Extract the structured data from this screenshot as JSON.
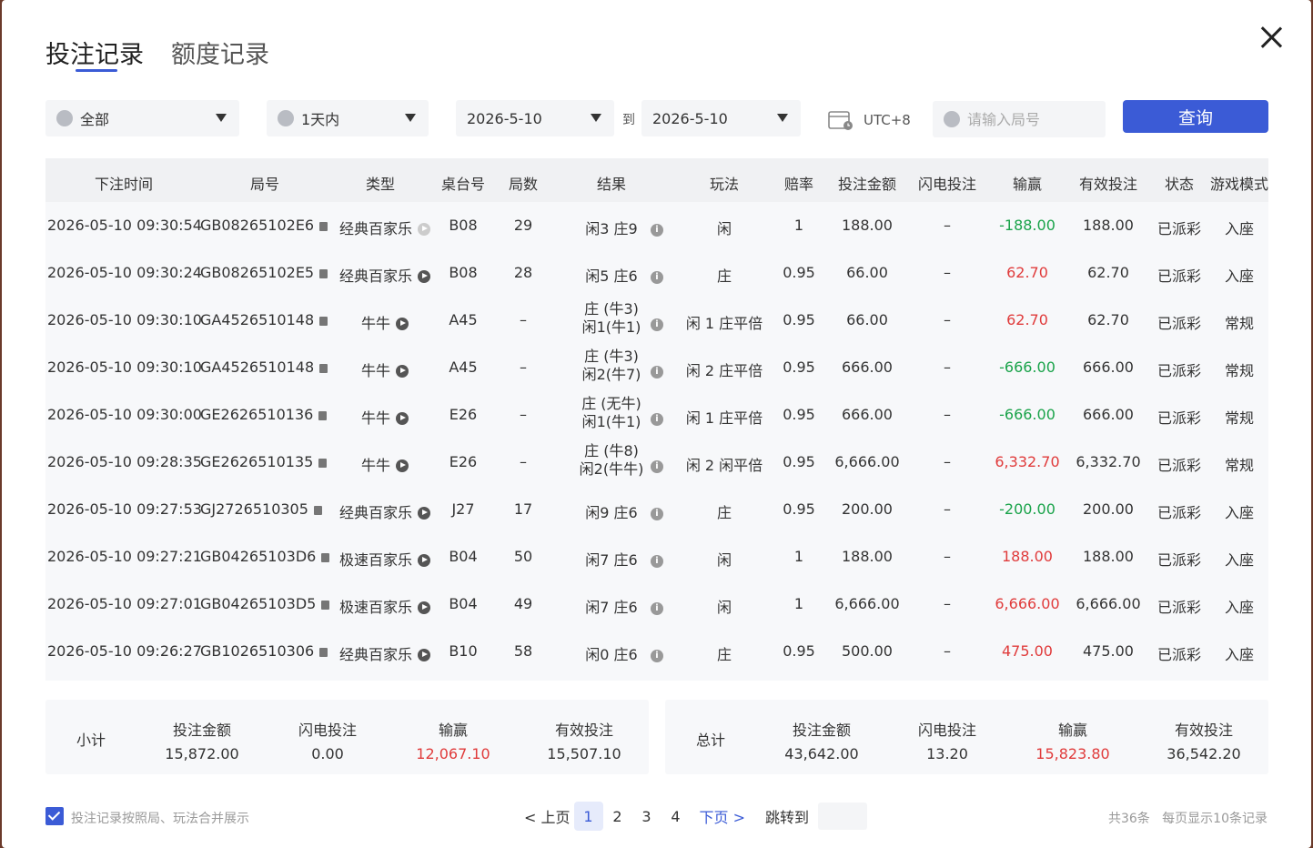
{
  "tabs": [
    "投注记录",
    "额度记录"
  ],
  "filters": {
    "type": "全部",
    "range": "1天内",
    "date_from": "2026-5-10",
    "to_label": "到",
    "date_to": "2026-5-10",
    "timezone": "UTC+8",
    "round_placeholder": "请输入局号",
    "query_label": "查询"
  },
  "table": {
    "headers": [
      "下注时间",
      "局号",
      "类型",
      "桌台号",
      "局数",
      "结果",
      "玩法",
      "赔率",
      "投注金额",
      "闪电投注",
      "输赢",
      "有效投注",
      "状态",
      "游戏模式"
    ],
    "rows": [
      {
        "time": "2026-05-10 09:30:54",
        "round": "GB08265102E6",
        "type": "经典百家乐",
        "table": "B08",
        "count": "29",
        "result1": "闲3 庄9",
        "result2": "",
        "play": "闲",
        "odds": "1",
        "amount": "188.00",
        "lightning": "–",
        "win": "-188.00",
        "win_color": "green",
        "valid": "188.00",
        "status": "已派彩",
        "mode": "入座",
        "play_dim": true
      },
      {
        "time": "2026-05-10 09:30:24",
        "round": "GB08265102E5",
        "type": "经典百家乐",
        "table": "B08",
        "count": "28",
        "result1": "闲5 庄6",
        "result2": "",
        "play": "庄",
        "odds": "0.95",
        "amount": "66.00",
        "lightning": "–",
        "win": "62.70",
        "win_color": "red",
        "valid": "62.70",
        "status": "已派彩",
        "mode": "入座"
      },
      {
        "time": "2026-05-10 09:30:10",
        "round": "GA4526510148",
        "type": "牛牛",
        "table": "A45",
        "count": "–",
        "result1": "庄 (牛3)",
        "result2": "闲1(牛1)",
        "play": "闲 1 庄平倍",
        "odds": "0.95",
        "amount": "66.00",
        "lightning": "–",
        "win": "62.70",
        "win_color": "red",
        "valid": "62.70",
        "status": "已派彩",
        "mode": "常规"
      },
      {
        "time": "2026-05-10 09:30:10",
        "round": "GA4526510148",
        "type": "牛牛",
        "table": "A45",
        "count": "–",
        "result1": "庄 (牛3)",
        "result2": "闲2(牛7)",
        "play": "闲 2 庄平倍",
        "odds": "0.95",
        "amount": "666.00",
        "lightning": "–",
        "win": "-666.00",
        "win_color": "green",
        "valid": "666.00",
        "status": "已派彩",
        "mode": "常规"
      },
      {
        "time": "2026-05-10 09:30:00",
        "round": "GE2626510136",
        "type": "牛牛",
        "table": "E26",
        "count": "–",
        "result1": "庄 (无牛)",
        "result2": "闲1(牛1)",
        "play": "闲 1 庄平倍",
        "odds": "0.95",
        "amount": "666.00",
        "lightning": "–",
        "win": "-666.00",
        "win_color": "green",
        "valid": "666.00",
        "status": "已派彩",
        "mode": "常规"
      },
      {
        "time": "2026-05-10 09:28:35",
        "round": "GE2626510135",
        "type": "牛牛",
        "table": "E26",
        "count": "–",
        "result1": "庄 (牛8)",
        "result2": "闲2(牛牛)",
        "play": "闲 2 闲平倍",
        "odds": "0.95",
        "amount": "6,666.00",
        "lightning": "–",
        "win": "6,332.70",
        "win_color": "red",
        "valid": "6,332.70",
        "status": "已派彩",
        "mode": "常规"
      },
      {
        "time": "2026-05-10 09:27:53",
        "round": "GJ2726510305",
        "type": "经典百家乐",
        "table": "J27",
        "count": "17",
        "result1": "闲9 庄6",
        "result2": "",
        "play": "庄",
        "odds": "0.95",
        "amount": "200.00",
        "lightning": "–",
        "win": "-200.00",
        "win_color": "green",
        "valid": "200.00",
        "status": "已派彩",
        "mode": "入座"
      },
      {
        "time": "2026-05-10 09:27:21",
        "round": "GB04265103D6",
        "type": "极速百家乐",
        "table": "B04",
        "count": "50",
        "result1": "闲7 庄6",
        "result2": "",
        "play": "闲",
        "odds": "1",
        "amount": "188.00",
        "lightning": "–",
        "win": "188.00",
        "win_color": "red",
        "valid": "188.00",
        "status": "已派彩",
        "mode": "入座"
      },
      {
        "time": "2026-05-10 09:27:01",
        "round": "GB04265103D5",
        "type": "极速百家乐",
        "table": "B04",
        "count": "49",
        "result1": "闲7 庄6",
        "result2": "",
        "play": "闲",
        "odds": "1",
        "amount": "6,666.00",
        "lightning": "–",
        "win": "6,666.00",
        "win_color": "red",
        "valid": "6,666.00",
        "status": "已派彩",
        "mode": "入座"
      },
      {
        "time": "2026-05-10 09:26:27",
        "round": "GB1026510306",
        "type": "经典百家乐",
        "table": "B10",
        "count": "58",
        "result1": "闲0 庄6",
        "result2": "",
        "play": "庄",
        "odds": "0.95",
        "amount": "500.00",
        "lightning": "–",
        "win": "475.00",
        "win_color": "red",
        "valid": "475.00",
        "status": "已派彩",
        "mode": "入座"
      }
    ]
  },
  "subtotal": {
    "label": "小计",
    "amount_label": "投注金额",
    "amount": "15,872.00",
    "lightning_label": "闪电投注",
    "lightning": "0.00",
    "win_label": "输赢",
    "win": "12,067.10",
    "valid_label": "有效投注",
    "valid": "15,507.10"
  },
  "total": {
    "label": "总计",
    "amount_label": "投注金额",
    "amount": "43,642.00",
    "lightning_label": "闪电投注",
    "lightning": "13.20",
    "win_label": "输赢",
    "win": "15,823.80",
    "valid_label": "有效投注",
    "valid": "36,542.20"
  },
  "footer": {
    "merge_label": "投注记录按照局、玩法合并展示",
    "prev": "< 上页",
    "pages": [
      "1",
      "2",
      "3",
      "4"
    ],
    "current_page": "1",
    "next": "下页 >",
    "jump_label": "跳转到",
    "total_count": "共36条",
    "per_page": "每页显示10条记录"
  },
  "colors": {
    "accent": "#3b5bd6",
    "win": "#e03b3b",
    "loss": "#1aa34a"
  }
}
